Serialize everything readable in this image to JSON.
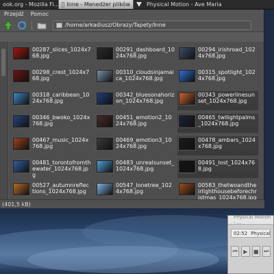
{
  "taskbar": {
    "tasks": [
      {
        "label": "ook.org - Mozilla Fi..."
      },
      {
        "label": "Inne - Menedżer plików"
      },
      {
        "label": "Physical Motion - Ave Maria"
      }
    ]
  },
  "menu": {
    "items": [
      "Przejdź",
      "Pomoc"
    ]
  },
  "location": {
    "path": "/home/arkadiusz/Obrazy/Tapety/Inne"
  },
  "files": [
    {
      "name": "00287_slices_1024x768.jpg",
      "color": "#a11610",
      "col": 0,
      "row": 0
    },
    {
      "name": "00291_dashboard_1024x768.jpg",
      "color": "#2a2a2a",
      "col": 1,
      "row": 0
    },
    {
      "name": "00294_irishroad_1024x768.jpg",
      "color": "#3b4f66",
      "col": 2,
      "row": 0
    },
    {
      "name": "00298_crest_1024x768.jpg",
      "color": "#6e1313",
      "col": 0,
      "row": 1
    },
    {
      "name": "00310_cloudsinjamaica_1024x768.jpg",
      "color": "#7a8fa8",
      "col": 1,
      "row": 1
    },
    {
      "name": "00315_spotlight_1024x768.jpg",
      "color": "#2f6fd1",
      "col": 2,
      "row": 1
    },
    {
      "name": "00318_caribbean_1024x768.jpg",
      "color": "#3f86c6",
      "col": 0,
      "row": 2
    },
    {
      "name": "00342_bluesonahorizon_1024x768.jpg",
      "color": "#1d3f7a",
      "col": 1,
      "row": 2
    },
    {
      "name": "00343_powerlinesunset_1024x768.jpg",
      "color": "#d0632d",
      "col": 2,
      "row": 2,
      "selected": true
    },
    {
      "name": "00346_bwoko_1024x768.jpg",
      "color": "#26437b",
      "col": 0,
      "row": 3
    },
    {
      "name": "00451_emotion2_1024x768.jpg",
      "color": "#4a2a2a",
      "col": 1,
      "row": 3
    },
    {
      "name": "00465_twilightpalms_1024x768.jpg",
      "color": "#1b2435",
      "col": 2,
      "row": 3,
      "selected": true
    },
    {
      "name": "00467_music_1024x768.jpg",
      "color": "#a04020",
      "col": 0,
      "row": 4
    },
    {
      "name": "00469_emotion3_1024x768.jpg",
      "color": "#3a3a3a",
      "col": 1,
      "row": 4
    },
    {
      "name": "00478_ambars_1024x768.jpg",
      "color": "#1a1a1a",
      "col": 2,
      "row": 4,
      "selected": true
    },
    {
      "name": "00481_torontofromthewater_1024x768.jpg",
      "color": "#2e5ea3",
      "col": 0,
      "row": 5
    },
    {
      "name": "00483_unrealsunset_1024x768.jpg",
      "color": "#4f9fd8",
      "col": 1,
      "row": 5
    },
    {
      "name": "00491_lost_1024x768.jpg",
      "color": "#141414",
      "col": 2,
      "row": 5,
      "selected": true
    },
    {
      "name": "00527_autumnreflections_1024x768.jpg",
      "color": "#b76b29",
      "col": 0,
      "row": 6
    },
    {
      "name": "00547_lonetree_1024x768.jpg",
      "color": "#7fb4e0",
      "col": 1,
      "row": 6
    },
    {
      "name": "00583_thetwoandtheirlighthousebeforechristmas_1024x768.jpg",
      "color": "#9a4a1c",
      "col": 2,
      "row": 6
    }
  ],
  "status": {
    "text": "(401,5 kB)"
  },
  "player": {
    "title": "Physical Motion - ...",
    "time": "02:52",
    "track": "Physical M..."
  }
}
